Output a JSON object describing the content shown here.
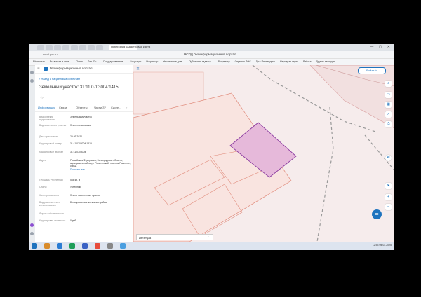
{
  "browser": {
    "tab_title": "Публичная кадастровая карта",
    "page_heading": "НСПД Геоинформационный портал",
    "url": "nspd.gov.ru",
    "bookmarks": [
      "ВКонтакте",
      "Вы вошли в сисе...",
      "Поиск",
      "Тип.Юр...",
      "Государственные...",
      "Госуслуги",
      "Росреестр",
      "Управление дом...",
      "Публичная кадастр...",
      "Росреестр",
      "Сервисы ФНС",
      "Гугл-Переводчик",
      "Народная карта",
      "Работа",
      "Другие закладки"
    ]
  },
  "app": {
    "title": "Геоинформационный портал",
    "back_link": "Назад к найденным объектам",
    "object_title": "Земельный участок: 31:11:0703004:1415",
    "tabs": [
      "Информация",
      "Связи",
      "Объекты",
      "Части ЗУ",
      "Систе..."
    ],
    "fields": [
      {
        "label": "Вид объекта недвижимости",
        "value": "Земельный участок"
      },
      {
        "label": "Вид земельного участка",
        "value": "Землепользование"
      },
      {
        "label": "Дата присвоения",
        "value": "29.09.2020"
      },
      {
        "label": "Кадастровый номер",
        "value": "31:11:0703004:1415"
      },
      {
        "label": "Кадастровый квартал",
        "value": "31:11:0703004"
      },
      {
        "label": "Адрес",
        "value": "Российская Федерация, Белгородская область, муниципальный округ Ракитянский, поселок Ракитное, улица",
        "link": "Показать все"
      },
      {
        "label": "Площадь уточненная",
        "value": "558 кв. м"
      },
      {
        "label": "Статус",
        "value": "Учтенный"
      },
      {
        "label": "Категория земель",
        "value": "Земли населенных пунктов"
      },
      {
        "label": "Вид разрешенного использования",
        "value": "Блокированная жилая застройка"
      },
      {
        "label": "Форма собственности",
        "value": "-"
      },
      {
        "label": "Кадастровая стоимость",
        "value": "0 руб."
      }
    ]
  },
  "map": {
    "login_label": "Войти",
    "legend_label": "Легенда",
    "selected_parcel_color": "#e6b9da",
    "parcel_border_color": "#e08a7a",
    "fab_icon": "chat-icon"
  },
  "taskbar": {
    "time": "12:53",
    "date": "04.03.2025"
  }
}
